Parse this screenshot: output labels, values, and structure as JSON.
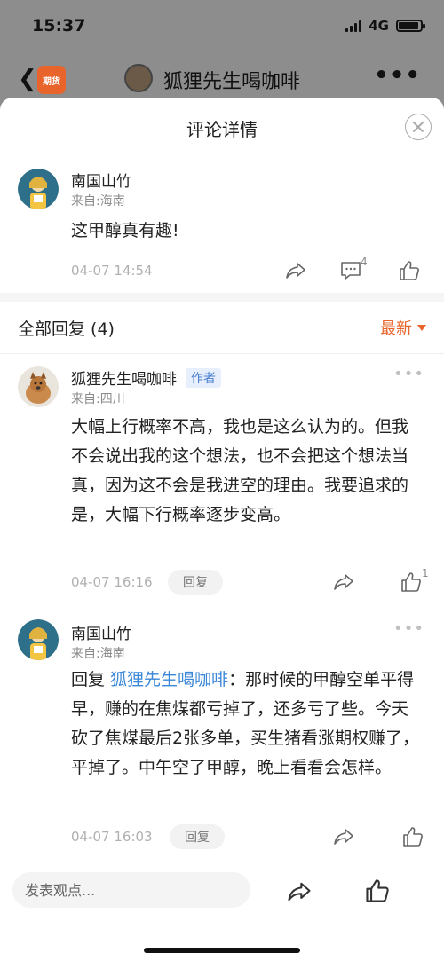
{
  "status": {
    "time": "15:37",
    "network": "4G"
  },
  "background_header": {
    "app_badge": "期货",
    "title": "狐狸先生喝咖啡"
  },
  "sheet": {
    "title": "评论详情"
  },
  "main_comment": {
    "user": "南国山竹",
    "location": "来自:海南",
    "text": "这甲醇真有趣!",
    "time": "04-07 14:54",
    "comment_count": "4"
  },
  "replies_section": {
    "title": "全部回复 (4)",
    "sort_label": "最新"
  },
  "replies": [
    {
      "user": "狐狸先生喝咖啡",
      "badge": "作者",
      "location": "来自:四川",
      "text": "大幅上行概率不高，我也是这么认为的。但我不会说出我的这个想法，也不会把这个想法当真，因为这不会是我进空的理由。我要追求的是，大幅下行概率逐步变高。",
      "time": "04-07 16:16",
      "reply_label": "回复",
      "like_count": "1"
    },
    {
      "user": "南国山竹",
      "location": "来自:海南",
      "reply_prefix": "回复 ",
      "reply_to": "狐狸先生喝咖啡",
      "text": "：那时候的甲醇空单平得早，赚的在焦煤都亏掉了，还多亏了些。今天砍了焦煤最后2张多单，买生猪看涨期权赚了，平掉了。中午空了甲醇，晚上看看会怎样。",
      "time": "04-07 16:03",
      "reply_label": "回复"
    }
  ],
  "bottom_bar": {
    "input_placeholder": "发表观点..."
  },
  "colors": {
    "accent": "#e8642a",
    "link": "#3a86d8",
    "badge_bg": "#e6effb"
  }
}
